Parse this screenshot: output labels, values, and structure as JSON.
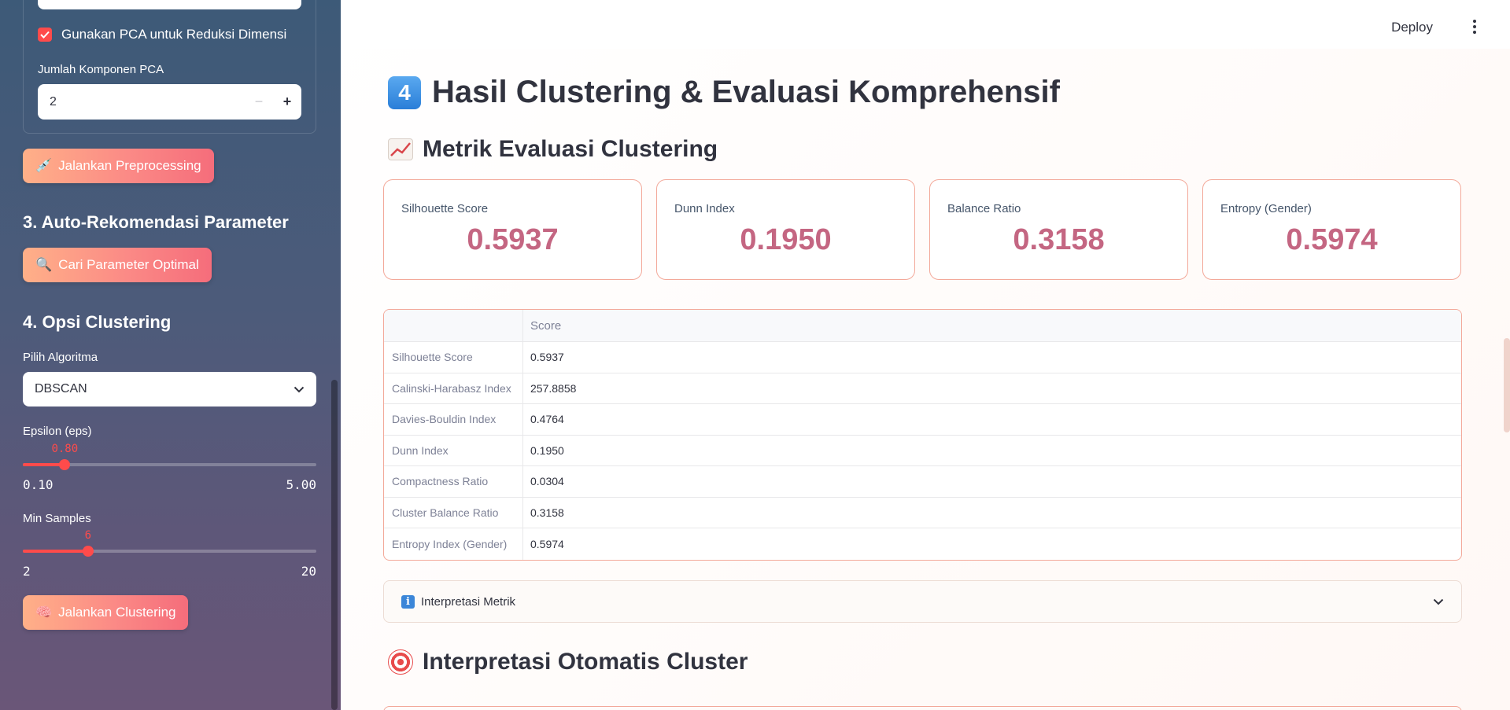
{
  "sidebar": {
    "pca_checkbox_label": "Gunakan PCA untuk Reduksi Dimensi",
    "pca_components_label": "Jumlah Komponen PCA",
    "pca_components_value": "2",
    "stepper_minus": "−",
    "stepper_plus": "+",
    "run_preprocessing": "Jalankan Preprocessing",
    "section3_title": "3. Auto-Rekomendasi Parameter",
    "find_params": "Cari Parameter Optimal",
    "section4_title": "4. Opsi Clustering",
    "algo_label": "Pilih Algoritma",
    "algo_value": "DBSCAN",
    "eps_label": "Epsilon (eps)",
    "eps_value": "0.80",
    "eps_min": "0.10",
    "eps_max": "5.00",
    "eps_fraction": 0.1429,
    "min_samples_label": "Min Samples",
    "min_samples_value": "6",
    "min_samples_min": "2",
    "min_samples_max": "20",
    "min_samples_fraction": 0.2222,
    "run_clustering": "Jalankan Clustering"
  },
  "topbar": {
    "deploy": "Deploy"
  },
  "main": {
    "title_number": "4",
    "title": "Hasil Clustering & Evaluasi Komprehensif",
    "metrics_heading": "Metrik Evaluasi Clustering",
    "cards": [
      {
        "label": "Silhouette Score",
        "value": "0.5937"
      },
      {
        "label": "Dunn Index",
        "value": "0.1950"
      },
      {
        "label": "Balance Ratio",
        "value": "0.3158"
      },
      {
        "label": "Entropy (Gender)",
        "value": "0.5974"
      }
    ],
    "table": {
      "header": [
        "",
        "Score"
      ],
      "rows": [
        [
          "Silhouette Score",
          "0.5937"
        ],
        [
          "Calinski-Harabasz Index",
          "257.8858"
        ],
        [
          "Davies-Bouldin Index",
          "0.4764"
        ],
        [
          "Dunn Index",
          "0.1950"
        ],
        [
          "Compactness Ratio",
          "0.0304"
        ],
        [
          "Cluster Balance Ratio",
          "0.3158"
        ],
        [
          "Entropy Index (Gender)",
          "0.5974"
        ]
      ]
    },
    "expander_label": "Interpretasi Metrik",
    "interpretation_heading": "Interpretasi Otomatis Cluster"
  },
  "colors": {
    "accent": "#ff4b4b",
    "metric_value": "#c46682",
    "card_border": "#f3a99a"
  }
}
